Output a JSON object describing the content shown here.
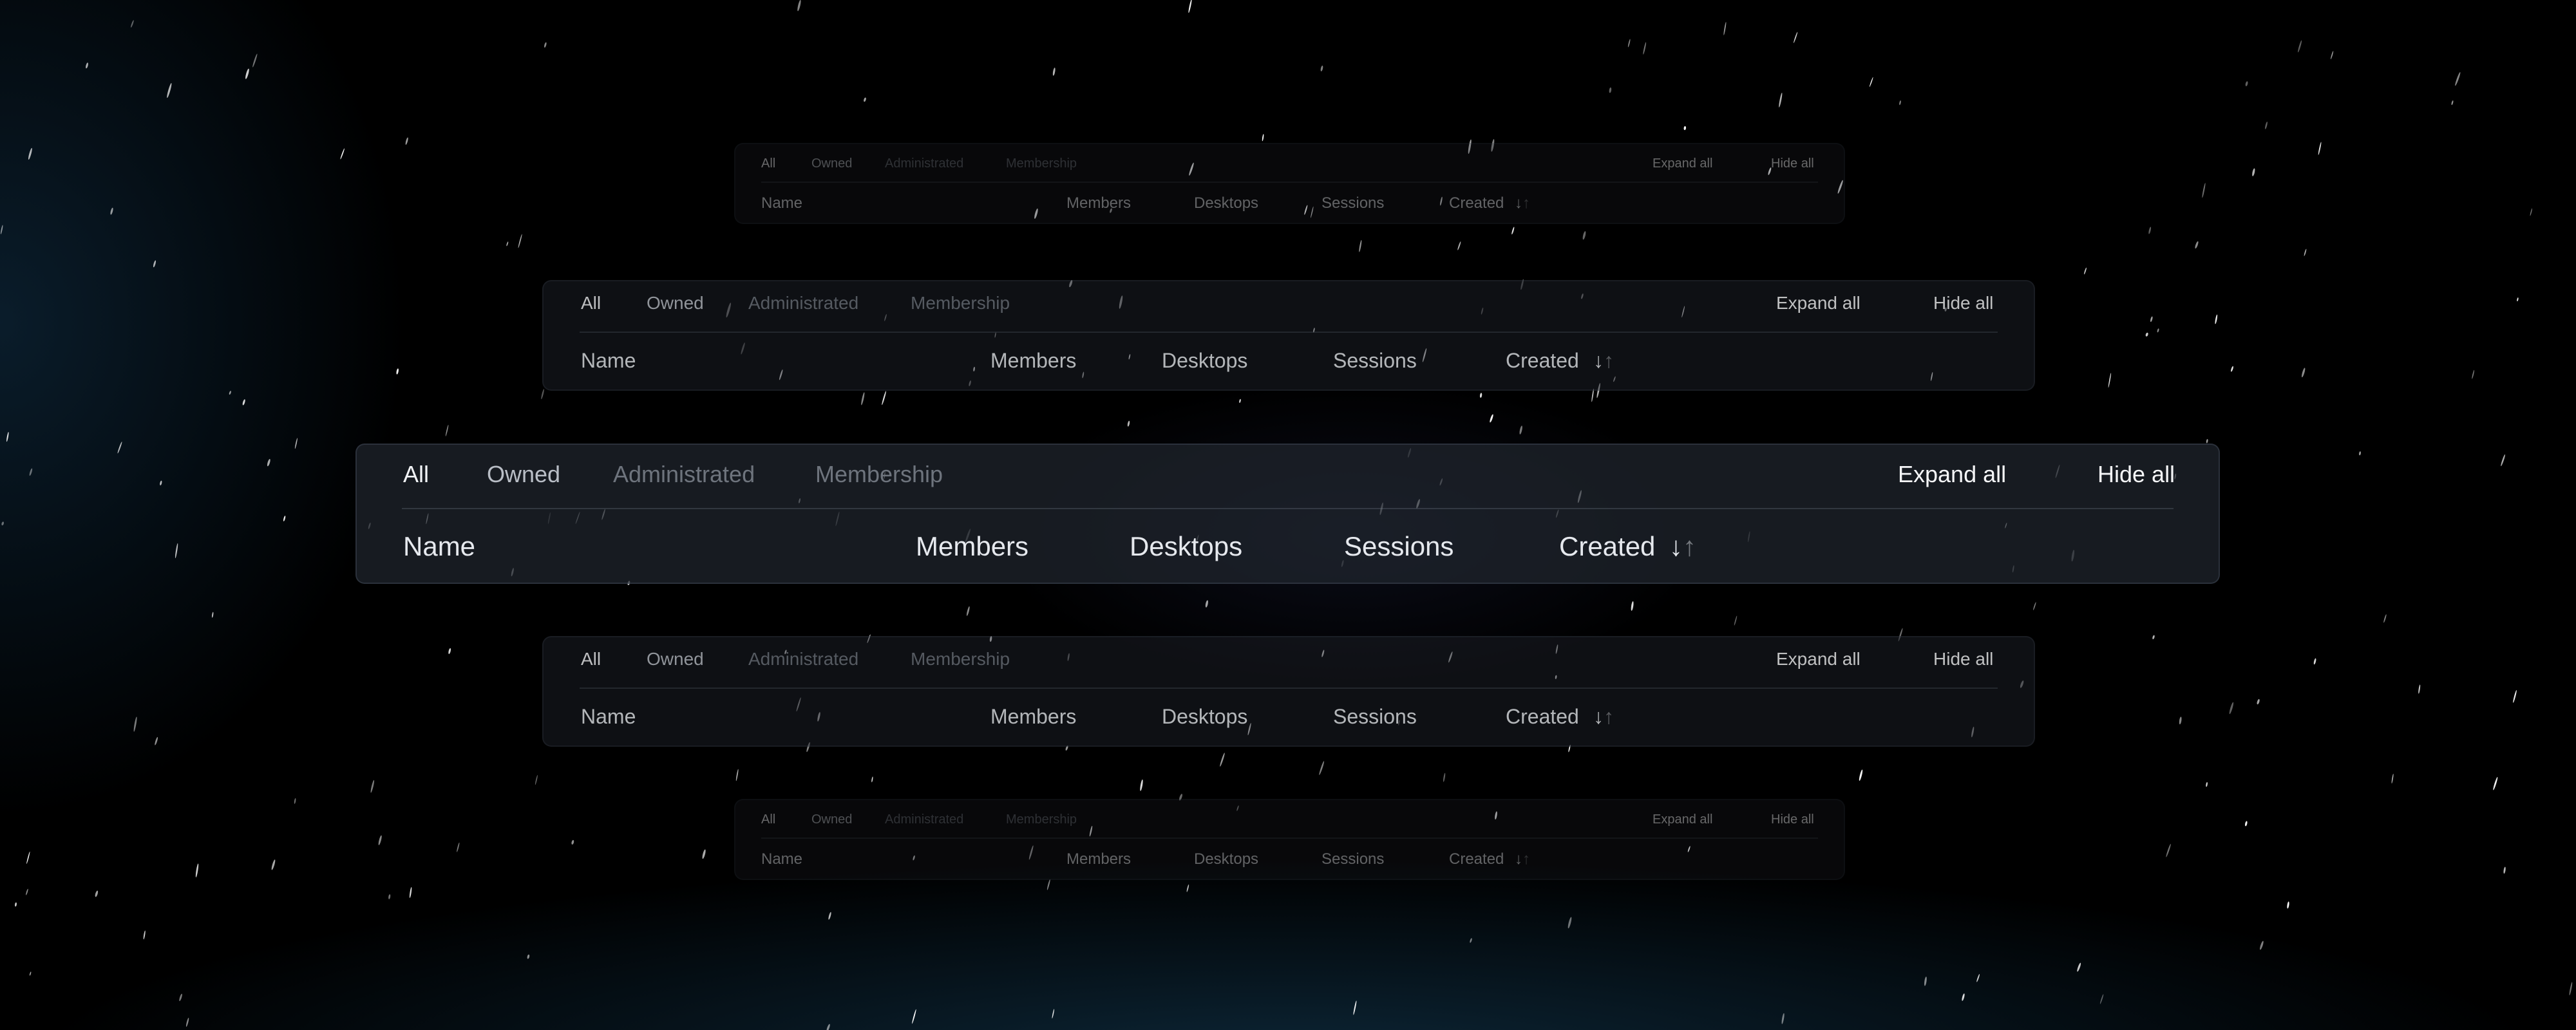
{
  "palette": {
    "background": "#000000",
    "panel": "#1e222a",
    "text_active": "#f2f4f7",
    "text_inactive": "#b9bec6",
    "text_disabled": "#6e747d"
  },
  "tabs": {
    "all": "All",
    "owned": "Owned",
    "administrated": "Administrated",
    "membership": "Membership"
  },
  "actions": {
    "expand_all": "Expand all",
    "hide_all": "Hide all"
  },
  "columns": {
    "name": "Name",
    "members": "Members",
    "desktops": "Desktops",
    "sessions": "Sessions",
    "created": "Created"
  },
  "sort_icon": {
    "down": "↓",
    "up": "↑",
    "icon_name": "sort-arrows-icon"
  }
}
